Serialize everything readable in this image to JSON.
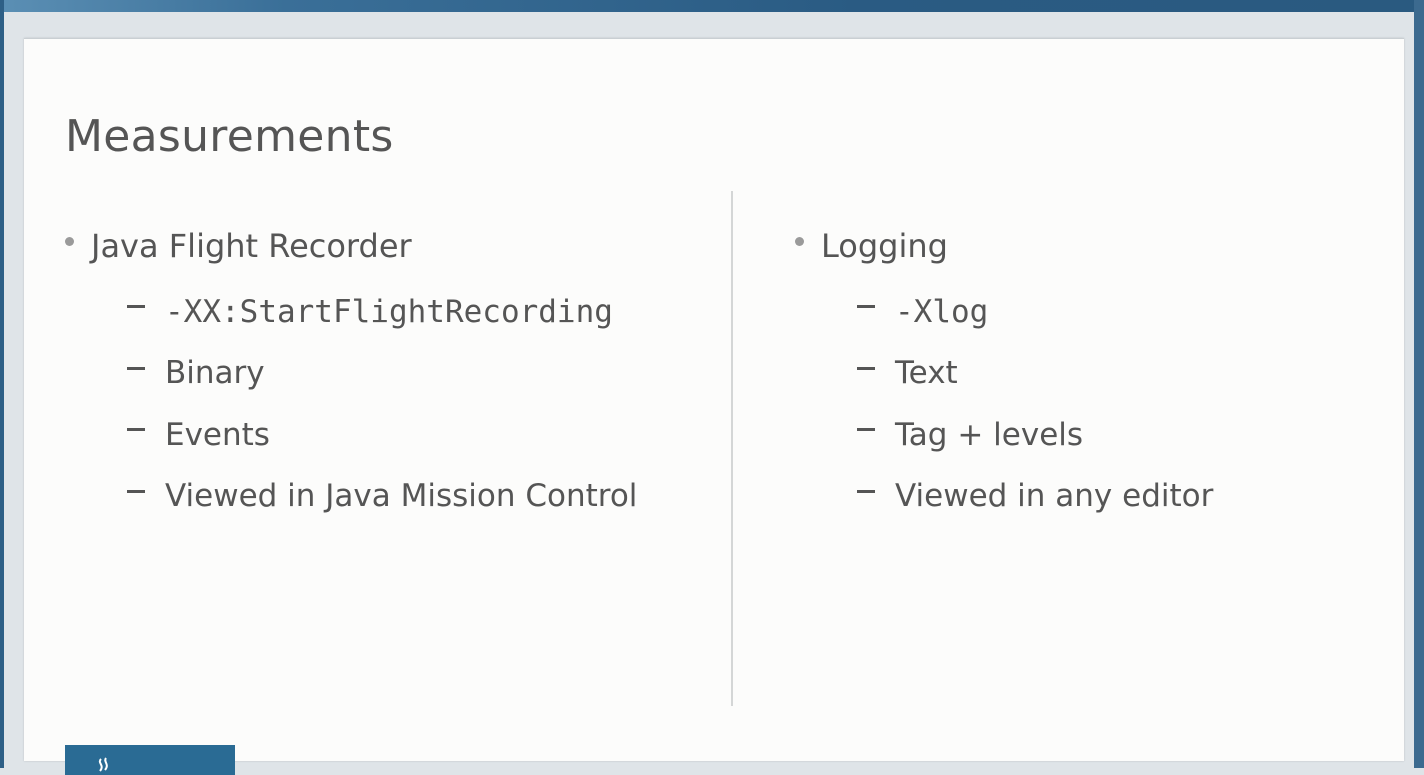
{
  "slide": {
    "title": "Measurements",
    "left_column": {
      "heading": "Java Flight Recorder",
      "items": [
        {
          "text": "-XX:StartFlightRecording",
          "mono": true
        },
        {
          "text": "Binary",
          "mono": false
        },
        {
          "text": "Events",
          "mono": false
        },
        {
          "text": "Viewed in Java Mission Control",
          "mono": false
        }
      ]
    },
    "right_column": {
      "heading": "Logging",
      "items": [
        {
          "text": "-Xlog",
          "mono": true
        },
        {
          "text": "Text",
          "mono": false
        },
        {
          "text": "Tag + levels",
          "mono": false
        },
        {
          "text": "Viewed in any editor",
          "mono": false
        }
      ]
    }
  },
  "colors": {
    "frame": "#2e5f86",
    "slide_bg": "#fcfcfb",
    "text": "#555555",
    "logo_bg": "#2a6b94"
  },
  "icons": {
    "logo": "java-cup-logo-icon"
  }
}
